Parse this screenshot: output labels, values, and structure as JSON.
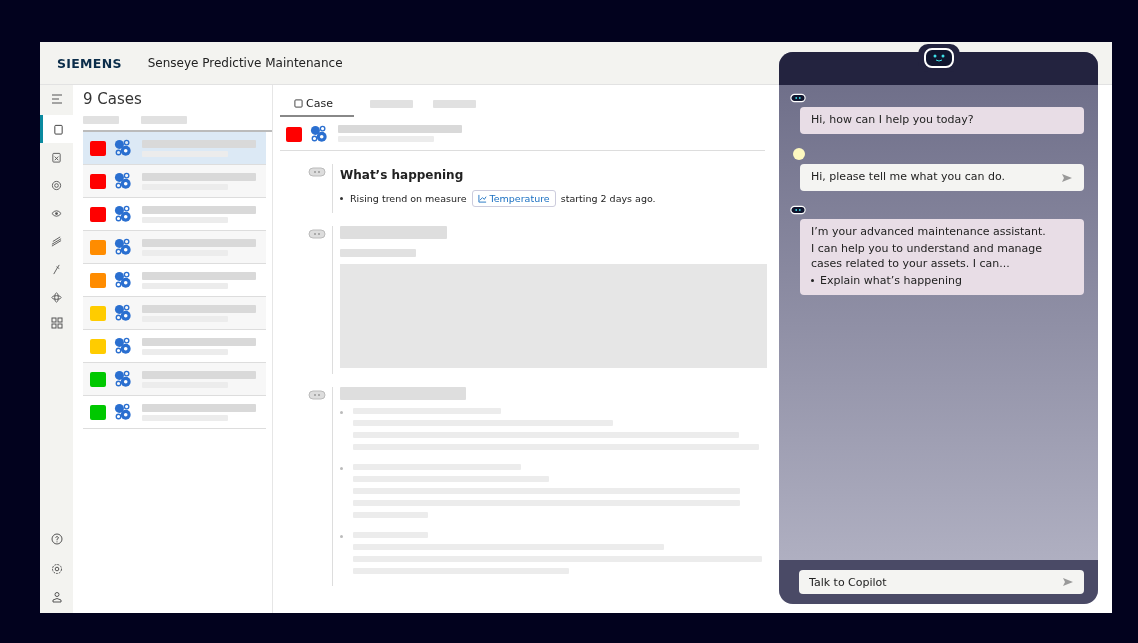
{
  "header": {
    "brand": "SIEMENS",
    "title": "Senseye Predictive Maintenance"
  },
  "sidebar": {
    "items": [
      {
        "selected": true
      },
      {
        "selected": false
      },
      {
        "selected": false
      },
      {
        "selected": false
      },
      {
        "selected": false
      },
      {
        "selected": false
      },
      {
        "selected": false
      }
    ]
  },
  "cases": {
    "title": "9 Cases",
    "rows": [
      {
        "color": "#ff0000",
        "selected": true
      },
      {
        "color": "#ff0000",
        "selected": false
      },
      {
        "color": "#ff0000",
        "selected": false
      },
      {
        "color": "#ff8c00",
        "selected": false
      },
      {
        "color": "#ff8c00",
        "selected": false
      },
      {
        "color": "#ffcc00",
        "selected": false
      },
      {
        "color": "#ffcc00",
        "selected": false
      },
      {
        "color": "#00c800",
        "selected": false
      },
      {
        "color": "#00c800",
        "selected": false
      }
    ]
  },
  "detail": {
    "tabs": [
      {
        "label": "Case",
        "selected": true
      }
    ],
    "section": {
      "title": "What’s happening",
      "bullet_before": "Rising trend on measure",
      "chip": "Temperature",
      "bullet_after": "starting 2 days ago."
    }
  },
  "copilot": {
    "messages": [
      {
        "kind": "bot",
        "lines": [
          "Hi, how can I help you today?"
        ]
      },
      {
        "kind": "user",
        "lines": [
          "Hi, please tell me what you can do."
        ]
      },
      {
        "kind": "bot",
        "lines": [
          "I’m your advanced maintenance assistant.",
          "I can help you to understand and manage cases related to your assets. I can..."
        ],
        "bullets": [
          "Explain what’s happening"
        ]
      }
    ],
    "input": {
      "placeholder": "Talk to Copilot"
    }
  }
}
